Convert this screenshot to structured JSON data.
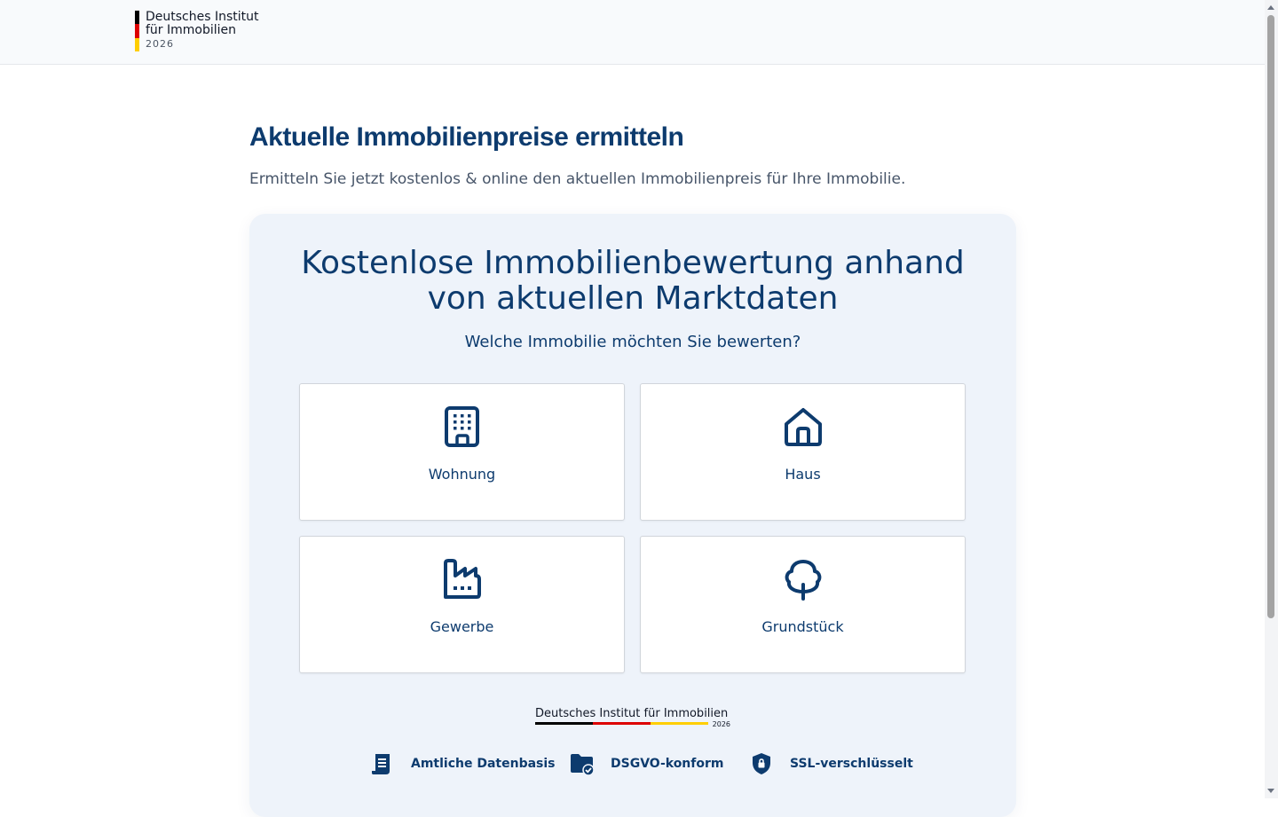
{
  "header": {
    "logo_line1": "Deutsches Institut",
    "logo_line2": "für Immobilien",
    "logo_year": "2026",
    "flag_colors": [
      "#000000",
      "#dd0000",
      "#ffce00"
    ]
  },
  "hero": {
    "title": "Aktuelle Immobilienpreise ermitteln",
    "subtitle": "Ermitteln Sie jetzt kostenlos & online den aktuellen Immobilienpreis für Ihre Immobilie."
  },
  "card": {
    "title": "Kostenlose Immobilienbewertung anhand von aktuellen Marktdaten",
    "question": "Welche Immobilie möchten Sie bewerten?",
    "options": [
      {
        "label": "Wohnung",
        "icon": "building-icon"
      },
      {
        "label": "Haus",
        "icon": "house-icon"
      },
      {
        "label": "Gewerbe",
        "icon": "factory-icon"
      },
      {
        "label": "Grundstück",
        "icon": "tree-icon"
      }
    ],
    "institute": {
      "name": "Deutsches Institut für Immobilien",
      "year": "2026"
    },
    "trust_badges": [
      {
        "label": "Amtliche Datenbasis",
        "icon": "document-icon"
      },
      {
        "label": "DSGVO-konform",
        "icon": "folder-check-icon"
      },
      {
        "label": "SSL-verschlüsselt",
        "icon": "shield-lock-icon"
      }
    ]
  },
  "colors": {
    "primary": "#0d3b6e",
    "card_bg": "#eef3fa"
  }
}
